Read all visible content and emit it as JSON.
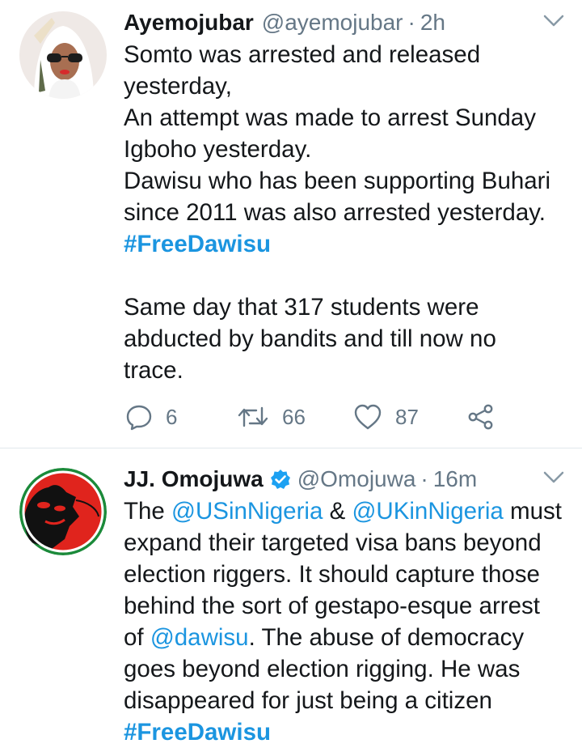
{
  "tweet1": {
    "name": "Ayemojubar",
    "handle": "@ayemojubar",
    "separator": "·",
    "time": "2h",
    "lines": [
      {
        "parts": [
          {
            "t": "Somto was arrested and released",
            "k": "text"
          }
        ]
      },
      {
        "parts": [
          {
            "t": "yesterday,",
            "k": "text"
          }
        ]
      },
      {
        "parts": [
          {
            "t": "An attempt was made to arrest Sunday",
            "k": "text"
          }
        ]
      },
      {
        "parts": [
          {
            "t": "Igboho yesterday.",
            "k": "text"
          }
        ]
      },
      {
        "parts": [
          {
            "t": "Dawisu who has been supporting Buhari",
            "k": "text"
          }
        ]
      },
      {
        "parts": [
          {
            "t": "since 2011 was also arrested yesterday.",
            "k": "text"
          }
        ]
      },
      {
        "parts": [
          {
            "t": "#FreeDawisu",
            "k": "hashtag"
          }
        ]
      },
      {
        "parts": [
          {
            "t": "",
            "k": "text"
          }
        ]
      },
      {
        "parts": [
          {
            "t": "Same day that 317 students were",
            "k": "text"
          }
        ]
      },
      {
        "parts": [
          {
            "t": "abducted by bandits and till now no",
            "k": "text"
          }
        ]
      },
      {
        "parts": [
          {
            "t": "trace.",
            "k": "text"
          }
        ]
      }
    ],
    "actions": {
      "reply_count": "6",
      "retweet_count": "66",
      "like_count": "87"
    },
    "icons": {
      "reply": "reply-icon",
      "retweet": "retweet-icon",
      "like": "heart-icon",
      "share": "share-icon",
      "menu": "chevron-down-icon"
    }
  },
  "tweet2": {
    "name": "JJ. Omojuwa",
    "handle": "@Omojuwa",
    "separator": "·",
    "time": "16m",
    "verified": true,
    "lines": [
      {
        "parts": [
          {
            "t": "The ",
            "k": "text"
          },
          {
            "t": "@USinNigeria",
            "k": "mention"
          },
          {
            "t": " & ",
            "k": "text"
          },
          {
            "t": "@UKinNigeria",
            "k": "mention"
          },
          {
            "t": " must",
            "k": "text"
          }
        ]
      },
      {
        "parts": [
          {
            "t": "expand their targeted visa bans beyond",
            "k": "text"
          }
        ]
      },
      {
        "parts": [
          {
            "t": "election riggers. It should capture those",
            "k": "text"
          }
        ]
      },
      {
        "parts": [
          {
            "t": "behind the sort of gestapo-esque arrest",
            "k": "text"
          }
        ]
      },
      {
        "parts": [
          {
            "t": "of ",
            "k": "text"
          },
          {
            "t": "@dawisu",
            "k": "mention"
          },
          {
            "t": ". The abuse of democracy",
            "k": "text"
          }
        ]
      },
      {
        "parts": [
          {
            "t": "goes beyond election rigging. He was",
            "k": "text"
          }
        ]
      },
      {
        "parts": [
          {
            "t": "disappeared for just being a citizen",
            "k": "text"
          }
        ]
      },
      {
        "parts": [
          {
            "t": "#FreeDawisu",
            "k": "hashtag"
          }
        ]
      }
    ]
  },
  "colors": {
    "link": "#1b95e0",
    "secondary": "#657786",
    "divider": "#e1e8ed",
    "verified": "#1da1f2"
  }
}
